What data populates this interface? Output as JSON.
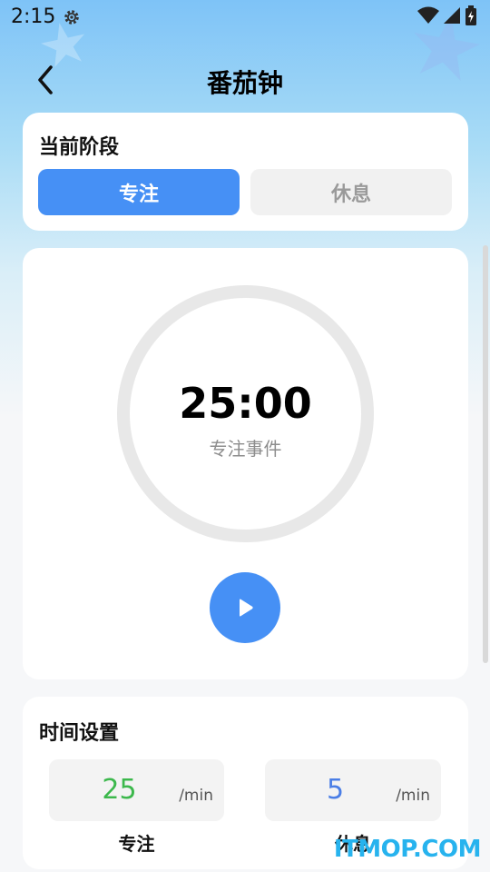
{
  "status_bar": {
    "time": "2:15"
  },
  "header": {
    "title": "番茄钟"
  },
  "phase_card": {
    "title": "当前阶段",
    "focus_label": "专注",
    "rest_label": "休息",
    "selected": "focus"
  },
  "timer": {
    "time": "25:00",
    "label": "专注事件",
    "progress": 0
  },
  "settings": {
    "title": "时间设置",
    "focus": {
      "value": "25",
      "unit": "/min",
      "caption": "专注"
    },
    "rest": {
      "value": "5",
      "unit": "/min",
      "caption": "休息"
    }
  },
  "watermark": "ITMOP.COM",
  "colors": {
    "accent": "#4690f5",
    "focus_value": "#3cb84c",
    "rest_value": "#4a7ee6",
    "ring": "#e8e8e8"
  },
  "icons": [
    "settings-gear-icon",
    "wifi-icon",
    "cell-signal-icon",
    "battery-charging-icon",
    "back-arrow-icon",
    "play-icon"
  ]
}
